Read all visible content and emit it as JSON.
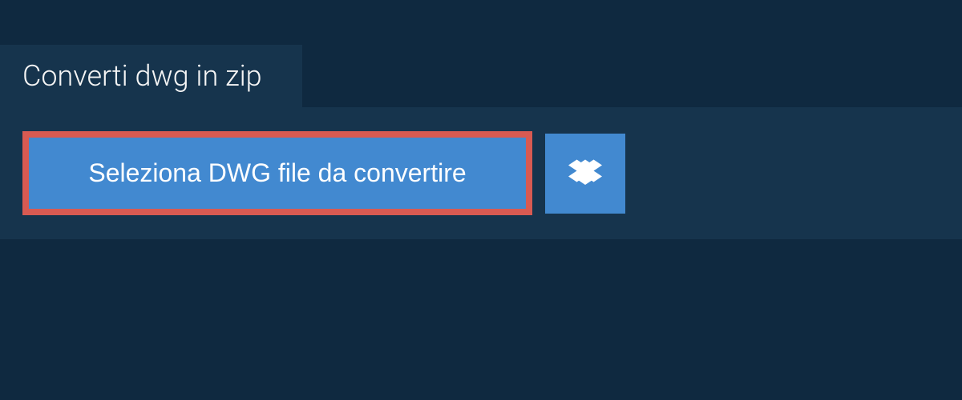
{
  "tab": {
    "title": "Converti dwg in zip"
  },
  "actions": {
    "select_file_label": "Seleziona DWG file da convertire"
  },
  "icons": {
    "dropbox": "dropbox-icon"
  },
  "colors": {
    "background_dark": "#0f2940",
    "panel": "#16344d",
    "button_blue": "#4289d0",
    "highlight_border": "#d85a52",
    "text_light": "#f5f5f5"
  }
}
